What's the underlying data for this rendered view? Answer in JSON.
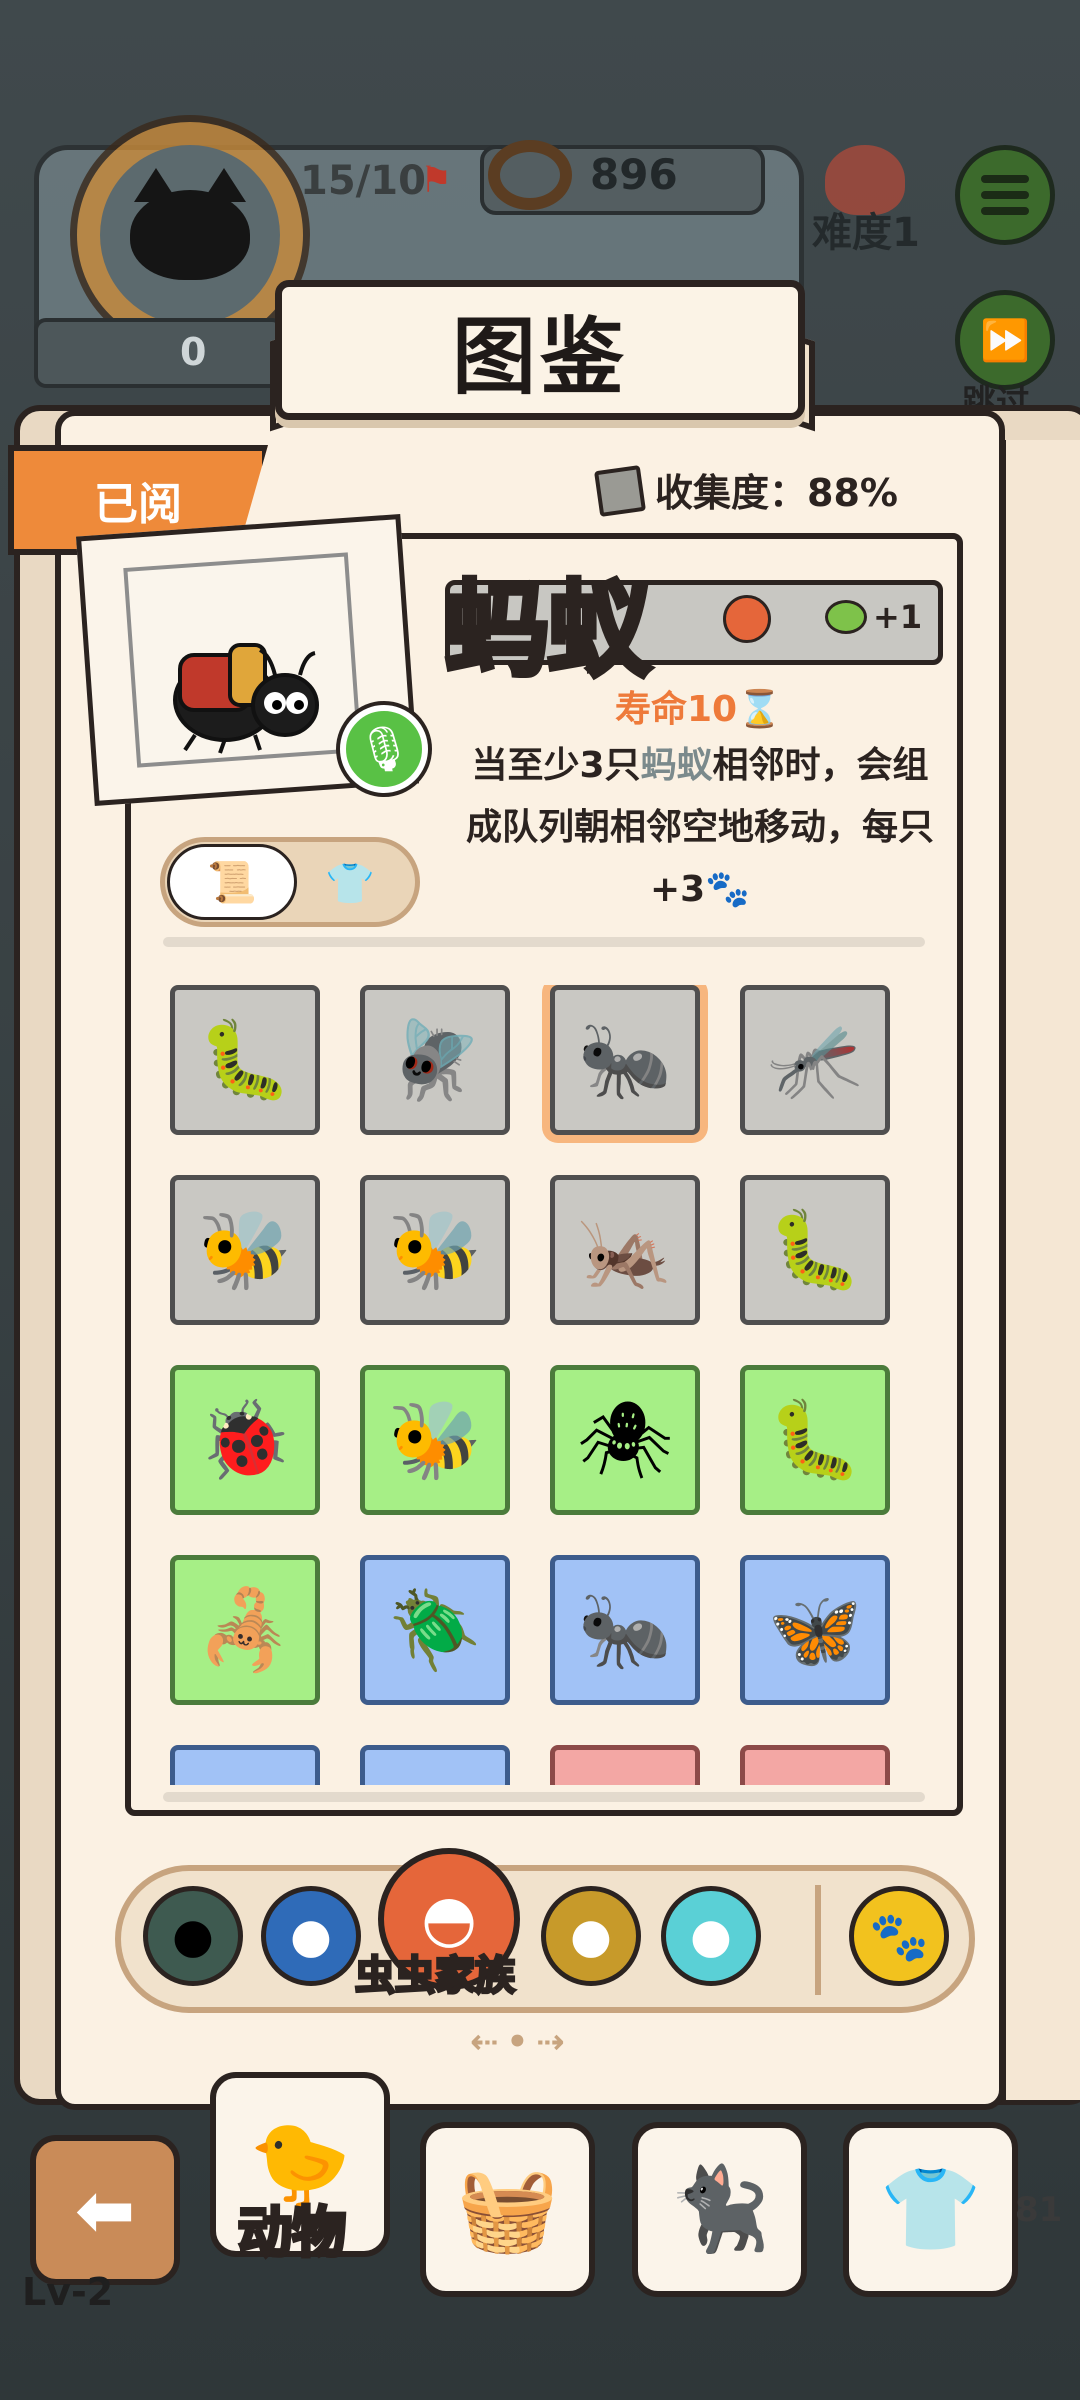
{
  "hud": {
    "count": "15/10",
    "coins": "896",
    "zero": "0",
    "difficulty": "难度1",
    "skip": "跳过"
  },
  "book": {
    "title": "图鉴",
    "read_tag": "已阅",
    "collection": "收集度：88%"
  },
  "creature": {
    "name": "蚂蚁",
    "bonus": "+1",
    "life_label": "寿命10",
    "desc_part1": "当至少3只",
    "desc_highlight": "蚂蚁",
    "desc_part2": "相邻时，会组成队列朝相邻空地移动，每只+3"
  },
  "grid": [
    {
      "color": "gray",
      "icon": "caterpillar-icon",
      "glyph": "🐛"
    },
    {
      "color": "gray",
      "icon": "fly-icon",
      "glyph": "🪰"
    },
    {
      "color": "gray",
      "icon": "ant-icon",
      "glyph": "🐜",
      "selected": true
    },
    {
      "color": "gray",
      "icon": "mosquito-icon",
      "glyph": "🦟"
    },
    {
      "color": "gray",
      "icon": "wasp-icon",
      "glyph": "🐝"
    },
    {
      "color": "gray",
      "icon": "bee-icon",
      "glyph": "🐝"
    },
    {
      "color": "gray",
      "icon": "grasshopper-icon",
      "glyph": "🦗"
    },
    {
      "color": "gray",
      "icon": "black-caterpillar-icon",
      "glyph": "🐛"
    },
    {
      "color": "green",
      "icon": "ladybug-icon",
      "glyph": "🐞"
    },
    {
      "color": "green",
      "icon": "queen-bee-icon",
      "glyph": "🐝"
    },
    {
      "color": "green",
      "icon": "spider-icon",
      "glyph": "🕷"
    },
    {
      "color": "green",
      "icon": "black-larva-icon",
      "glyph": "🐛"
    },
    {
      "color": "green",
      "icon": "scorpion-silhouette-icon",
      "glyph": "🦂"
    },
    {
      "color": "blue",
      "icon": "beetle-icon",
      "glyph": "🪲"
    },
    {
      "color": "blue",
      "icon": "queen-ant-icon",
      "glyph": "🐜"
    },
    {
      "color": "blue",
      "icon": "butterfly-icon",
      "glyph": "🦋"
    },
    {
      "color": "blue",
      "icon": "partial-icon",
      "glyph": ""
    },
    {
      "color": "blue",
      "icon": "partial-icon",
      "glyph": ""
    },
    {
      "color": "pink",
      "icon": "partial-icon",
      "glyph": ""
    },
    {
      "color": "pink",
      "icon": "partial-icon",
      "glyph": ""
    }
  ],
  "categories": {
    "selected_label": "虫虫家族"
  },
  "nav": {
    "level": "Lv-2",
    "animal": "动物",
    "side_number": "81"
  },
  "colors": {
    "accent_orange": "#ee8a3a",
    "page": "#fbf1e3",
    "ink": "#2b2320"
  }
}
